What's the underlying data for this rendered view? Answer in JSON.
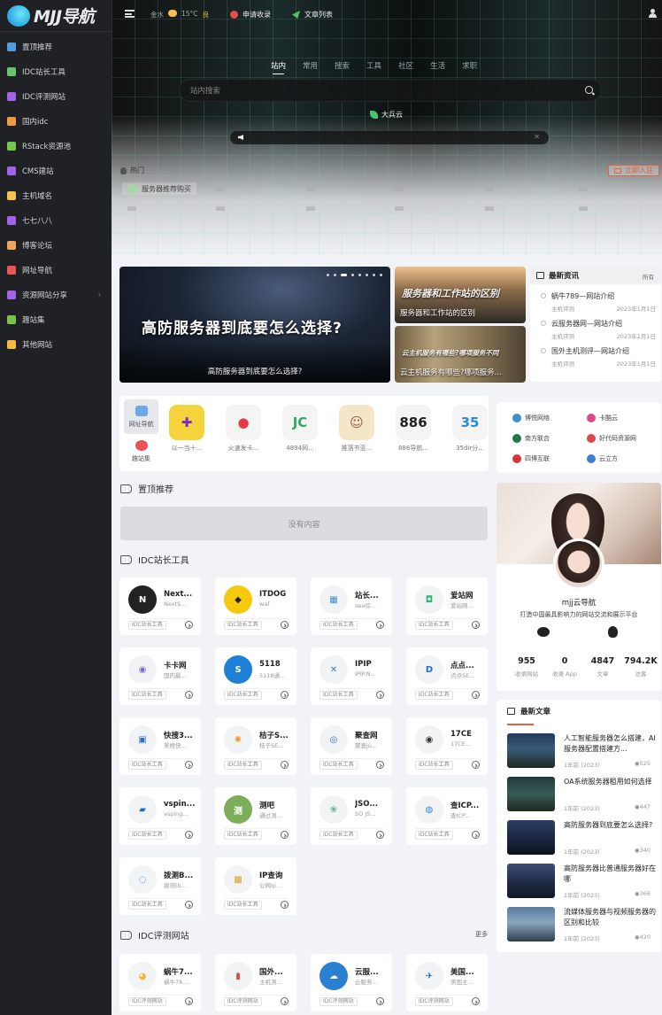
{
  "brand": {
    "name": "MJJ导航"
  },
  "sidebar": {
    "items": [
      {
        "label": "置顶推荐",
        "color": "#4f9ee0"
      },
      {
        "label": "IDC站长工具",
        "color": "#6ac26c"
      },
      {
        "label": "IDC评测网站",
        "color": "#a463e6"
      },
      {
        "label": "国内idc",
        "color": "#f09a3e"
      },
      {
        "label": "RStack资源池",
        "color": "#77c94b"
      },
      {
        "label": "CMS建站",
        "color": "#a463e6"
      },
      {
        "label": "主机域名",
        "color": "#f5c14b"
      },
      {
        "label": "七七八八",
        "color": "#a463e6"
      },
      {
        "label": "博客论坛",
        "color": "#f0a65a"
      },
      {
        "label": "网址导航",
        "color": "#e95656"
      },
      {
        "label": "资源网站分享",
        "color": "#a463e6",
        "arrow": "›"
      },
      {
        "label": "趣站集",
        "color": "#7ac24a"
      },
      {
        "label": "其他网站",
        "color": "#f5b942"
      }
    ]
  },
  "topbar": {
    "weather_city": "金水",
    "weather_temp": "15°C",
    "weather_aqi": "良",
    "link1": "申请收录",
    "link2": "文章列表"
  },
  "search": {
    "tabs": [
      "站内",
      "常用",
      "搜索",
      "工具",
      "社区",
      "生活",
      "求职"
    ],
    "placeholder": "站内搜索",
    "engine": "大兵云"
  },
  "hot": {
    "label": "热门",
    "enter_button": "立即入驻",
    "first_item": "服务器推荐购买"
  },
  "slider": {
    "headline": "高防服务器到底要怎么选择?",
    "caption": "高防服务器到底要怎么选择?",
    "dots": 8
  },
  "thumbs": [
    {
      "big": "服务器和工作站的区别",
      "caption": "服务器和工作站的区别"
    },
    {
      "big": "云主机服务有哪些?哪项服务不同",
      "caption": "云主机服务有哪些?哪项服务..."
    }
  ],
  "news": {
    "title": "最新资讯",
    "more": "所有",
    "items": [
      {
        "title": "蜗牛789—网站介绍",
        "cat": "主机评测",
        "date": "2023年1月1日"
      },
      {
        "title": "云服务器网—网站介绍",
        "cat": "主机评测",
        "date": "2023年1月1日"
      },
      {
        "title": "国外主机测评—网站介绍",
        "cat": "主机评测",
        "date": "2023年1月1日"
      }
    ]
  },
  "dock": {
    "tabs": [
      "网址导航",
      "趣站集"
    ],
    "apps": [
      {
        "label": "以一当十...",
        "glyph": "✚",
        "color": "#7b2cbf",
        "bg": "#f6d33c"
      },
      {
        "label": "火速发卡...",
        "glyph": "●",
        "color": "#e63946",
        "bg": "#f4f4f4"
      },
      {
        "label": "4894网...",
        "glyph": "JC",
        "color": "#2ea86b",
        "bg": "#f4f4f4"
      },
      {
        "label": "推落书亚...",
        "glyph": "☺",
        "color": "#8d5a3b",
        "bg": "#f5e6c8"
      },
      {
        "label": "886导航...",
        "glyph": "886",
        "color": "#222",
        "bg": "#f4f4f4"
      },
      {
        "label": "35dir分...",
        "glyph": "35",
        "color": "#2a8ad8",
        "bg": "#f4f4f4"
      }
    ]
  },
  "partners": [
    {
      "label": "博悦网络",
      "color": "#3e8ed0"
    },
    {
      "label": "卡酷云",
      "color": "#d94a8c"
    },
    {
      "label": "南方联合",
      "color": "#1f7a46"
    },
    {
      "label": "好代码资源网",
      "color": "#e04848"
    },
    {
      "label": "四博互联",
      "color": "#d43535"
    },
    {
      "label": "云立方",
      "color": "#3c7ed8"
    }
  ],
  "sections": {
    "top": {
      "title": "置顶推荐",
      "empty": "没有内容"
    },
    "tools": {
      "title": "IDC站长工具"
    },
    "reviews": {
      "title": "IDC评测网站",
      "more": "更多"
    }
  },
  "tools": [
    {
      "name": "Next...",
      "desc": "NextS...",
      "tag": "IDC站长工具",
      "glyph": "N",
      "fg": "#fff",
      "bg": "#222"
    },
    {
      "name": "ITDOG",
      "desc": "waf",
      "tag": "IDC站长工具",
      "glyph": "◆",
      "fg": "#222",
      "bg": "#f6c90e"
    },
    {
      "name": "站长...",
      "desc": "seo综...",
      "tag": "IDC站长工具",
      "glyph": "▦",
      "fg": "#3e8ed0",
      "bg": "#f2f3f5"
    },
    {
      "name": "爱站网",
      "desc": "爱站网...",
      "tag": "IDC站长工具",
      "glyph": "◘",
      "fg": "#2eb872",
      "bg": "#f2f3f5"
    },
    {
      "name": "卡卡网",
      "desc": "国内最...",
      "tag": "IDC站长工具",
      "glyph": "◉",
      "fg": "#7b6bd8",
      "bg": "#f2f3f5"
    },
    {
      "name": "5118",
      "desc": "5118通...",
      "tag": "IDC站长工具",
      "glyph": "S",
      "fg": "#fff",
      "bg": "#1d7fd6"
    },
    {
      "name": "IPIP",
      "desc": "IPIP.N...",
      "tag": "IDC站长工具",
      "glyph": "✕",
      "fg": "#2b86d1",
      "bg": "#f2f3f5"
    },
    {
      "name": "点点...",
      "desc": "点点SE...",
      "tag": "IDC站长工具",
      "glyph": "D",
      "fg": "#1f6fd6",
      "bg": "#f2f3f5"
    },
    {
      "name": "快搜3...",
      "desc": "美橙快...",
      "tag": "IDC站长工具",
      "glyph": "▣",
      "fg": "#2b6fd0",
      "bg": "#f2f3f5"
    },
    {
      "name": "桔子S...",
      "desc": "桔子SE...",
      "tag": "IDC站长工具",
      "glyph": "✺",
      "fg": "#f29a2e",
      "bg": "#f2f3f5"
    },
    {
      "name": "聚查网",
      "desc": "聚查ju...",
      "tag": "IDC站长工具",
      "glyph": "◎",
      "fg": "#2c6bc4",
      "bg": "#f2f3f5"
    },
    {
      "name": "17CE",
      "desc": "17CE...",
      "tag": "IDC站长工具",
      "glyph": "◉",
      "fg": "#333",
      "bg": "#f2f3f5"
    },
    {
      "name": "vspin...",
      "desc": "vsping...",
      "tag": "IDC站长工具",
      "glyph": "▰",
      "fg": "#1f6fd6",
      "bg": "#f2f3f5"
    },
    {
      "name": "测吧",
      "desc": "通过测...",
      "tag": "IDC站长工具",
      "glyph": "测",
      "fg": "#fff",
      "bg": "#7cae5a"
    },
    {
      "name": "JSO...",
      "desc": "SO JS...",
      "tag": "IDC站长工具",
      "glyph": "❀",
      "fg": "#5ab59a",
      "bg": "#f2f3f5"
    },
    {
      "name": "查ICP...",
      "desc": "查ICP...",
      "tag": "IDC站长工具",
      "glyph": "◍",
      "fg": "#2a8ad8",
      "bg": "#f2f3f5"
    },
    {
      "name": "拨测B...",
      "desc": "拨测(b...",
      "tag": "IDC站长工具",
      "glyph": "◌",
      "fg": "#2a8ad8",
      "bg": "#f2f3f5"
    },
    {
      "name": "IP查询",
      "desc": "公网ip...",
      "tag": "IDC站长工具",
      "glyph": "▩",
      "fg": "#d9a12c",
      "bg": "#f2f3f5"
    }
  ],
  "reviews": [
    {
      "name": "蜗牛7...",
      "desc": "蜗牛78...",
      "tag": "IDC评测网站",
      "glyph": "◕",
      "fg": "#f2b632",
      "bg": "#f2f3f5"
    },
    {
      "name": "国外...",
      "desc": "主机测...",
      "tag": "IDC评测网站",
      "glyph": "▮",
      "fg": "#e04848",
      "bg": "#f2f3f5"
    },
    {
      "name": "云服...",
      "desc": "云服务...",
      "tag": "IDC评测网站",
      "glyph": "☁",
      "fg": "#fff",
      "bg": "#2a7fd0"
    },
    {
      "name": "美国...",
      "desc": "美国主...",
      "tag": "IDC评测网站",
      "glyph": "✈",
      "fg": "#1d5fae",
      "bg": "#f2f3f5"
    }
  ],
  "profile": {
    "name": "mjj云导航",
    "desc": "打造中国最具影响力的网站交流和展示平台",
    "stats": [
      {
        "value": "955",
        "label": "收录网站"
      },
      {
        "value": "0",
        "label": "收录 App"
      },
      {
        "value": "4847",
        "label": "文章"
      },
      {
        "value": "794.2K",
        "label": "访客"
      }
    ]
  },
  "articles": {
    "title": "最新文章",
    "items": [
      {
        "title": "人工智能服务器怎么搭建，AI服务器配置搭建方...",
        "date": "1年前 (2023)",
        "views": "525"
      },
      {
        "title": "OA系统服务器租用如何选择",
        "date": "1年前 (2023)",
        "views": "447"
      },
      {
        "title": "高防服务器到底要怎么选择?",
        "date": "1年前 (2023)",
        "views": "340"
      },
      {
        "title": "高防服务器比普通服务器好在哪",
        "date": "1年前 (2023)",
        "views": "366"
      },
      {
        "title": "流媒体服务器与视频服务器的区别和比较",
        "date": "1年前 (2023)",
        "views": "420"
      }
    ]
  }
}
